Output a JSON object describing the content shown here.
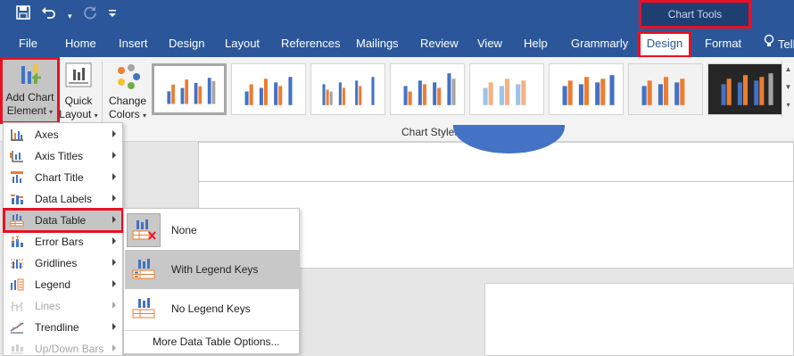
{
  "qat": {
    "save_icon": "save-icon",
    "undo_icon": "undo-icon",
    "redo_icon": "redo-icon",
    "customize_icon": "customize-qat-icon"
  },
  "context": {
    "chart_tools": "Chart Tools"
  },
  "tabs": [
    {
      "label": "File"
    },
    {
      "label": "Home"
    },
    {
      "label": "Insert"
    },
    {
      "label": "Design"
    },
    {
      "label": "Layout"
    },
    {
      "label": "References"
    },
    {
      "label": "Mailings"
    },
    {
      "label": "Review"
    },
    {
      "label": "View"
    },
    {
      "label": "Help"
    },
    {
      "label": "Grammarly"
    },
    {
      "label": "Design"
    },
    {
      "label": "Format"
    },
    {
      "label": "Tell"
    }
  ],
  "ribbon": {
    "add_chart_line1": "Add Chart",
    "add_chart_line2": "Element",
    "quick_layout_line1": "Quick",
    "quick_layout_line2": "Layout",
    "change_colors_line1": "Change",
    "change_colors_line2": "Colors",
    "chart_styles_label": "Chart Styles"
  },
  "menu": {
    "items": [
      {
        "label": "Axes"
      },
      {
        "label": "Axis Titles"
      },
      {
        "label": "Chart Title"
      },
      {
        "label": "Data Labels"
      },
      {
        "label": "Data Table"
      },
      {
        "label": "Error Bars"
      },
      {
        "label": "Gridlines"
      },
      {
        "label": "Legend"
      },
      {
        "label": "Lines"
      },
      {
        "label": "Trendline"
      },
      {
        "label": "Up/Down Bars"
      }
    ]
  },
  "submenu": {
    "items": [
      {
        "label": "None"
      },
      {
        "label": "With Legend Keys"
      },
      {
        "label": "No Legend Keys"
      }
    ],
    "footer": "More Data Table Options..."
  },
  "colors": {
    "ribbon_blue": "#2b579a",
    "highlight_red": "#e81123",
    "chart_orange": "#ed7d31",
    "chart_blue": "#4472c4"
  }
}
